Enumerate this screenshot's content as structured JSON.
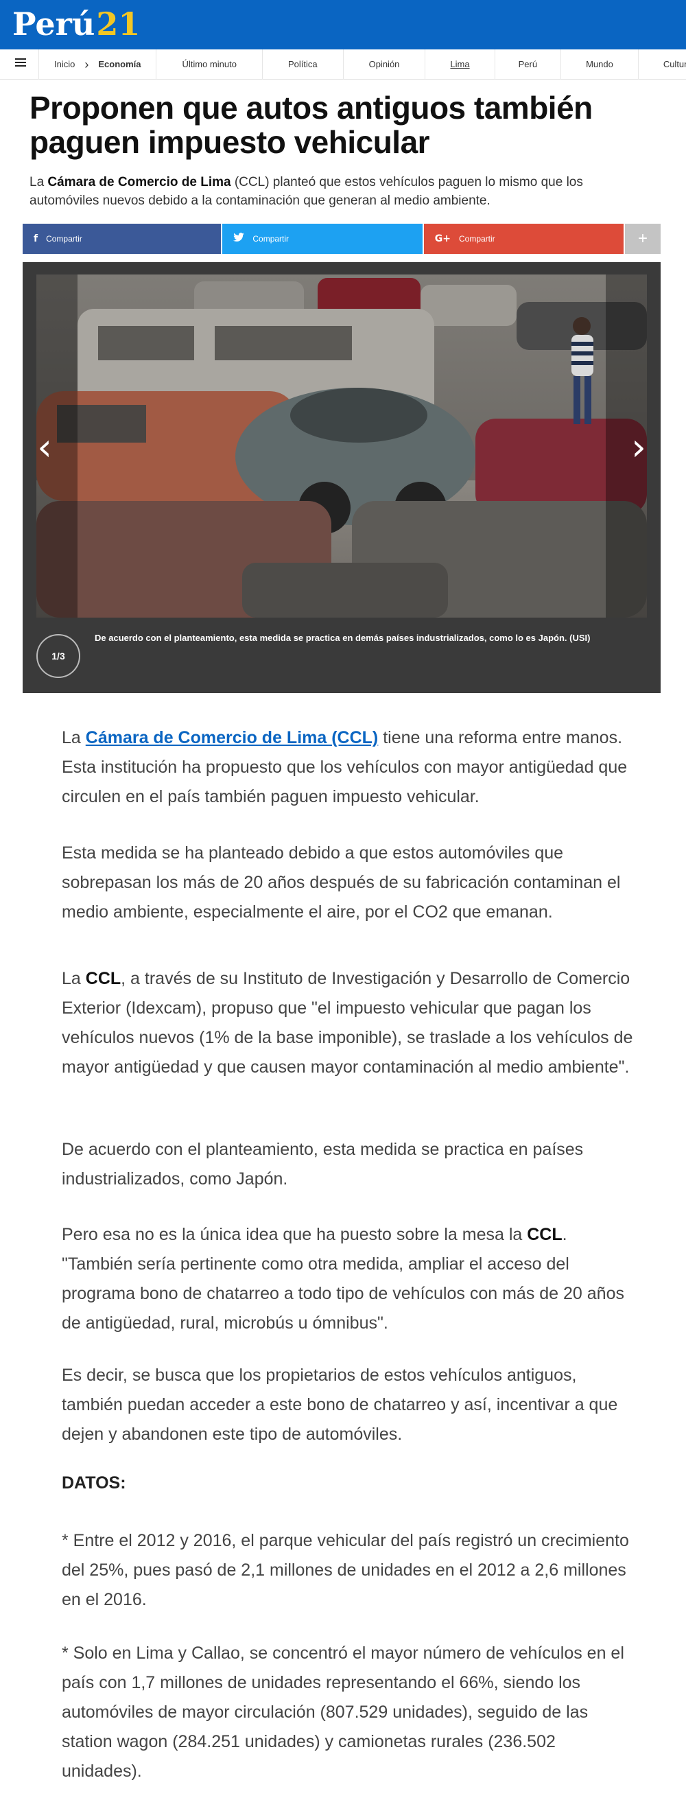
{
  "header": {
    "logo_word": "Perú",
    "logo_num": "21"
  },
  "nav": {
    "breadcrumb_home": "Inicio",
    "breadcrumb_section": "Economía",
    "items": [
      "Último minuto",
      "Política",
      "Opinión",
      "Lima",
      "Perú",
      "Mundo",
      "Cultura"
    ]
  },
  "article": {
    "title": "Proponen que autos antiguos también paguen impuesto vehicular",
    "summary_pre": "La ",
    "summary_bold": "Cámara de Comercio de Lima",
    "summary_post": " (CCL) planteó que estos vehículos paguen lo mismo que los automóviles nuevos debido a la contaminación que generan al medio ambiente."
  },
  "share": {
    "facebook_label": "Compartir",
    "twitter_label": "Compartir",
    "google_label": "Compartir",
    "more_label": "+"
  },
  "gallery": {
    "caption": "De acuerdo con el planteamiento, esta medida se practica en demás países industrializados, como lo es Japón.  (USI)",
    "counter": "1/3",
    "prev_icon": "chevron-left-icon",
    "next_icon": "chevron-right-icon"
  },
  "body": {
    "p1_pre": "La ",
    "p1_link": "Cámara de Comercio de Lima (CCL)",
    "p1_post": " tiene una reforma entre manos. Esta institución ha propuesto que los vehículos con mayor antigüedad que circulen en el país también paguen impuesto vehicular.",
    "p2": "Esta medida se ha planteado debido a que estos automóviles que sobrepasan los más de 20 años después de su fabricación contaminan el medio ambiente, especialmente el aire, por el CO2 que emanan.",
    "p3_pre": "La ",
    "p3_bold": "CCL",
    "p3_post": ", a través de su Instituto de Investigación y Desarrollo de Comercio Exterior (Idexcam), propuso que \"el impuesto vehicular que pagan los vehículos nuevos (1% de la base imponible), se traslade a los vehículos de mayor antigüedad y que causen mayor contaminación al medio ambiente\".",
    "p4": "De acuerdo con el planteamiento, esta medida se practica en países industrializados, como Japón.",
    "p5_pre": "Pero esa no es la única idea que ha puesto sobre la mesa la ",
    "p5_bold": "CCL",
    "p5_post": ". \"También sería pertinente como otra medida, ampliar el acceso del programa bono de chatarreo a todo tipo de vehículos con más de 20 años de antigüedad, rural, microbús u ómnibus\".",
    "p6": "Es decir, se busca que los propietarios de estos vehículos antiguos, también puedan acceder a este bono de chatarreo y así, incentivar a que dejen y abandonen este tipo de automóviles.",
    "datos_heading": "DATOS:",
    "d1": "* Entre el 2012 y 2016, el parque vehicular del país registró un crecimiento del 25%, pues pasó de 2,1 millones de unidades en el 2012 a 2,6 millones en el 2016.",
    "d2": "* Solo en Lima y Callao, se concentró el mayor número de vehículos en el país con 1,7 millones de unidades representando el 66%, siendo los automóviles de mayor circulación (807.529 unidades), seguido de las station wagon (284.251 unidades) y camionetas rurales (236.502 unidades)."
  },
  "colors": {
    "brand_blue": "#0a65c2",
    "logo_yellow": "#f3c623",
    "facebook": "#3b5998",
    "twitter": "#1da1f2",
    "google": "#dd4b39"
  }
}
